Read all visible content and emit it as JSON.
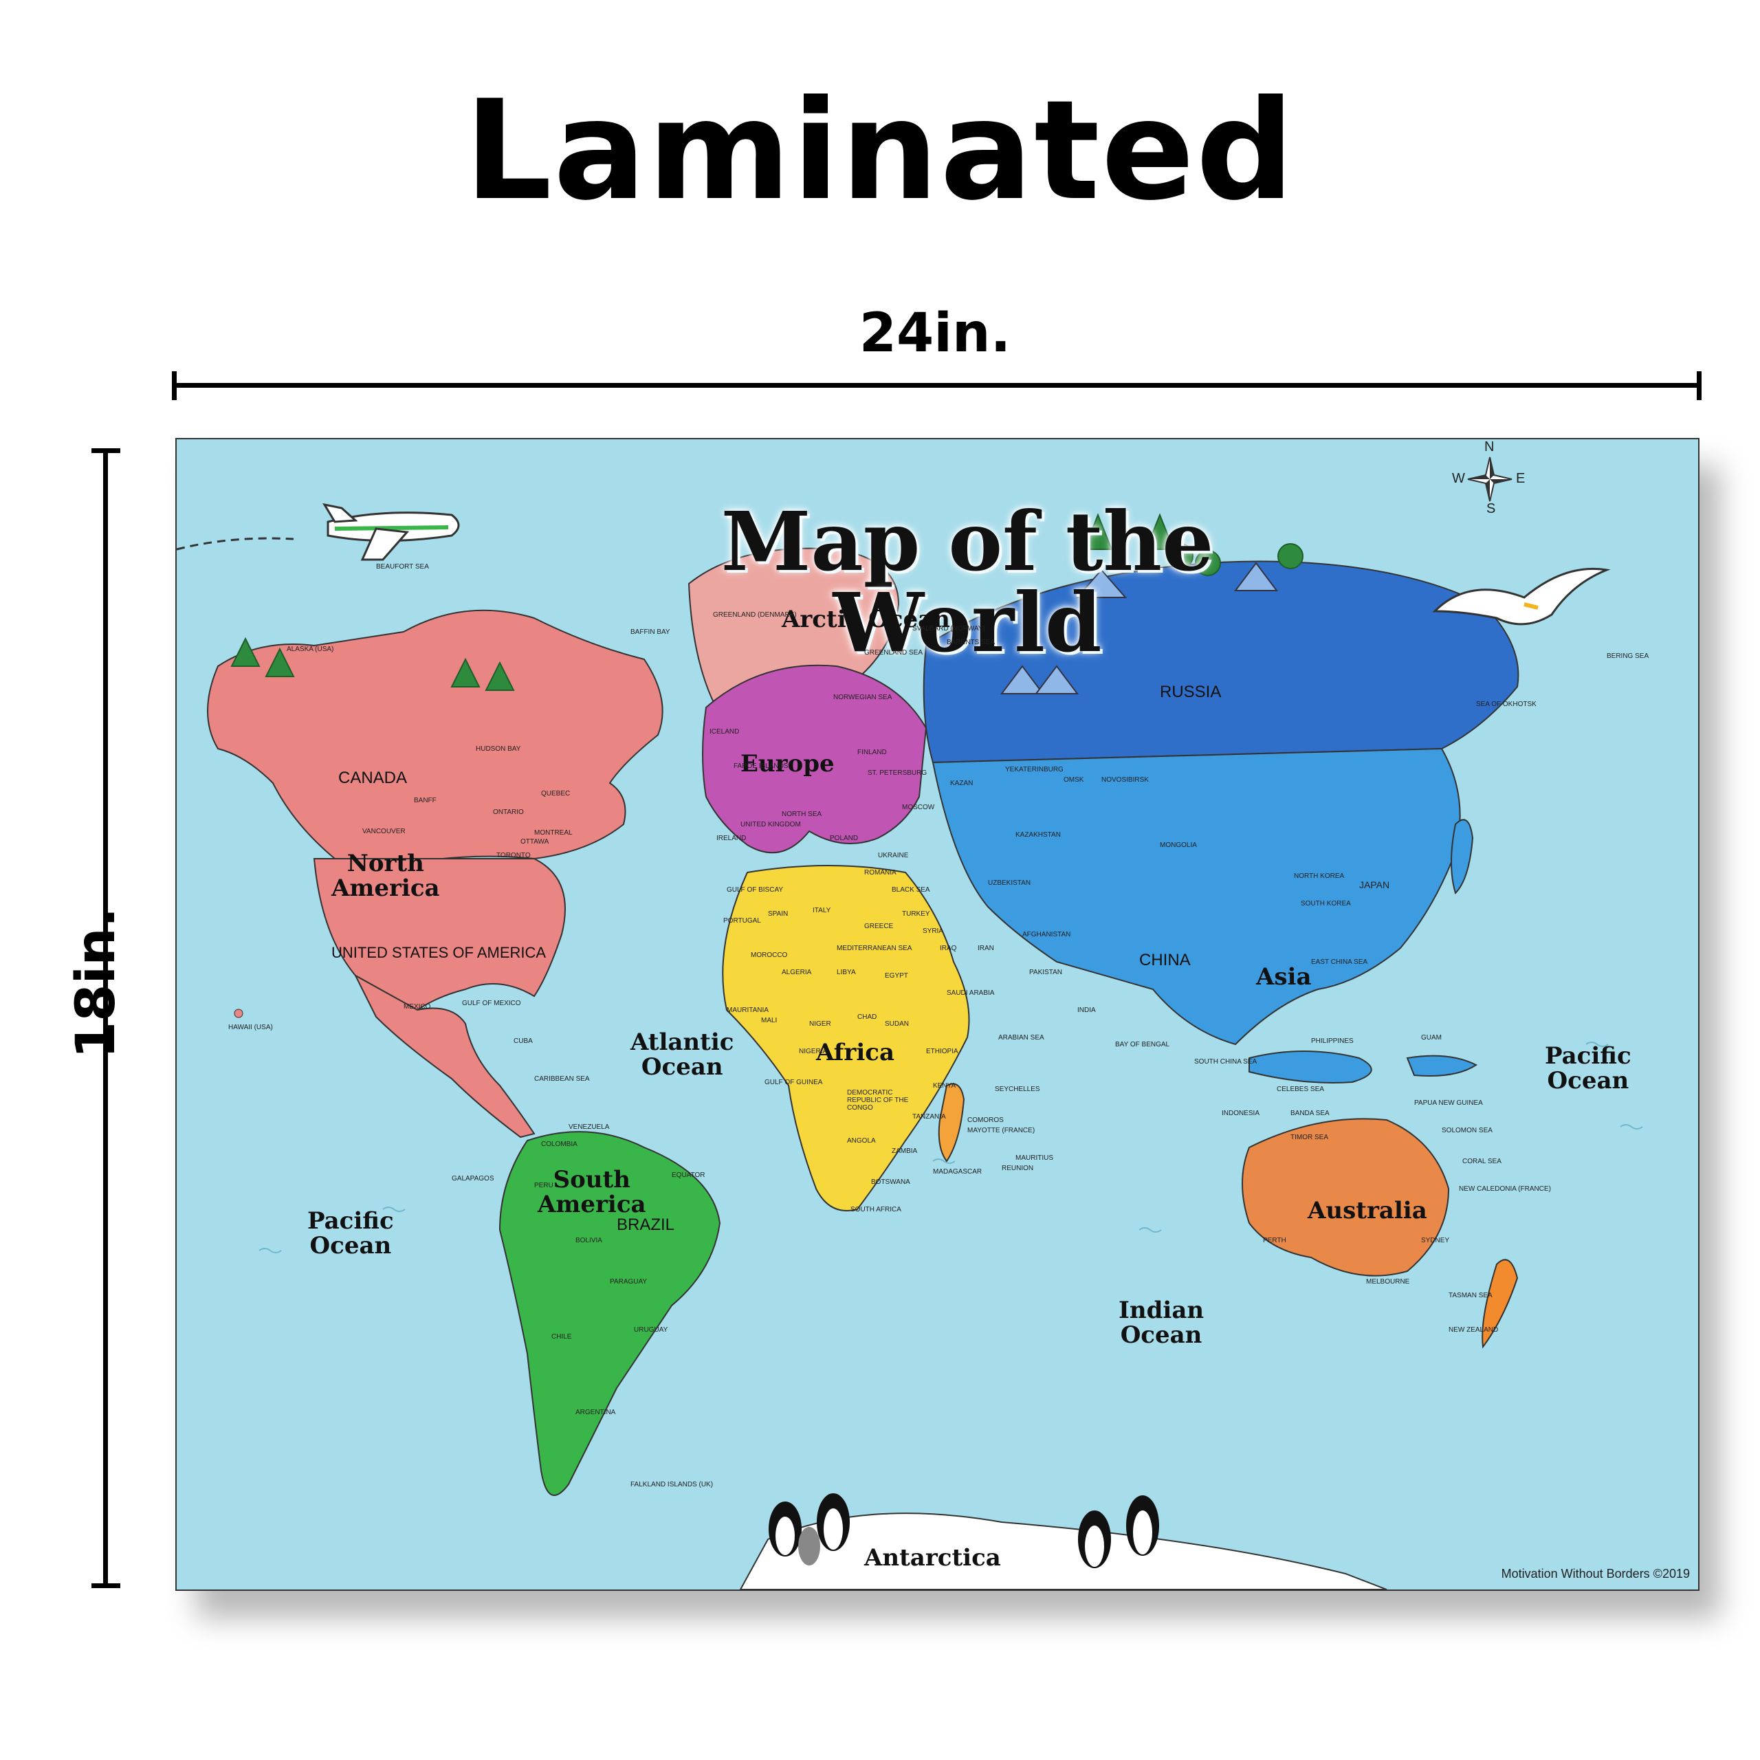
{
  "headline": "Laminated",
  "dimensions": {
    "width_label": "24in.",
    "height_label": "18in."
  },
  "poster": {
    "title": "Map of the World",
    "credit": "Motivation Without Borders ©2019",
    "compass": {
      "n": "N",
      "s": "S",
      "e": "E",
      "w": "W"
    },
    "continents": {
      "north_america": "North\nAmerica",
      "south_america": "South\nAmerica",
      "europe": "Europe",
      "africa": "Africa",
      "asia": "Asia",
      "australia": "Australia",
      "antarctica": "Antarctica"
    },
    "oceans": {
      "arctic": "Arctic Ocean",
      "atlantic": "Atlantic\nOcean",
      "pacific_west": "Pacific\nOcean",
      "pacific_east": "Pacific\nOcean",
      "indian": "Indian\nOcean"
    },
    "countries": {
      "canada": "CANADA",
      "usa": "UNITED STATES OF AMERICA",
      "russia": "RUSSIA",
      "china": "CHINA",
      "brazil": "BRAZIL"
    },
    "small_labels": {
      "beaufort_sea": "BEAUFORT SEA",
      "alaska": "ALASKA (USA)",
      "greenland": "GREENLAND (DENMARK)",
      "baffin_bay": "BAFFIN BAY",
      "greenland_sea": "GREENLAND SEA",
      "svalbard": "SVALBARD (NORWAY)",
      "barents_sea": "BARENTS SEA",
      "norwegian_sea": "NORWEGIAN SEA",
      "hudson_bay": "HUDSON BAY",
      "banff": "BANFF",
      "vancouver": "VANCOUVER",
      "ontario": "ONTARIO",
      "quebec": "QUEBEC",
      "montreal": "MONTREAL",
      "ottawa": "OTTAWA",
      "toronto": "TORONTO",
      "mexico": "MEXICO",
      "gulf_of_mexico": "GULF OF MEXICO",
      "cuba": "CUBA",
      "caribbean_sea": "CARIBBEAN SEA",
      "hawaii": "HAWAII (USA)",
      "venezuela": "VENEZUELA",
      "colombia": "COLOMBIA",
      "peru": "PERU",
      "bolivia": "BOLIVIA",
      "chile": "CHILE",
      "argentina": "ARGENTINA",
      "paraguay": "PARAGUAY",
      "uruguay": "URUGUAY",
      "galapagos": "GALAPAGOS",
      "equator": "EQUATOR",
      "falkland": "FALKLAND ISLANDS (UK)",
      "united_kingdom": "UNITED KINGDOM",
      "north_sea": "NORTH SEA",
      "ireland": "IRELAND",
      "gulf_of_biscay": "GULF OF BISCAY",
      "portugal": "PORTUGAL",
      "spain": "SPAIN",
      "italy": "ITALY",
      "greece": "GREECE",
      "poland": "POLAND",
      "ukraine": "UKRAINE",
      "romania": "ROMANIA",
      "finland": "FINLAND",
      "faroe": "FAROE ISLANDS",
      "iceland": "ICELAND",
      "mediterranean": "MEDITERRANEAN SEA",
      "black_sea": "BLACK SEA",
      "turkey": "TURKEY",
      "st_petersburg": "ST. PETERSBURG",
      "moscow": "MOSCOW",
      "kazan": "KAZAN",
      "yekaterinburg": "YEKATERINBURG",
      "omsk": "OMSK",
      "novosibirsk": "NOVOSIBIRSK",
      "kazakhstan": "KAZAKHSTAN",
      "mongolia": "MONGOLIA",
      "uzbekistan": "UZBEKISTAN",
      "afghanistan": "AFGHANISTAN",
      "pakistan": "PAKISTAN",
      "india": "INDIA",
      "iran": "IRAN",
      "iraq": "IRAQ",
      "syria": "SYRIA",
      "saudi_arabia": "SAUDI ARABIA",
      "arabian_sea": "ARABIAN SEA",
      "bay_of_bengal": "BAY OF BENGAL",
      "north_korea": "NORTH KOREA",
      "south_korea": "SOUTH KOREA",
      "japan": "JAPAN",
      "east_china_sea": "EAST CHINA SEA",
      "south_china_sea": "SOUTH CHINA SEA",
      "philippines": "PHILIPPINES",
      "guam": "GUAM",
      "indonesia": "INDONESIA",
      "banda_sea": "BANDA SEA",
      "celebes_sea": "CELEBES SEA",
      "papua": "PAPUA NEW GUINEA",
      "solomon_sea": "SOLOMON SEA",
      "timor_sea": "TIMOR SEA",
      "coral_sea": "CORAL SEA",
      "new_caledonia": "NEW CALEDONIA (FRANCE)",
      "perth": "PERTH",
      "sydney": "SYDNEY",
      "melbourne": "MELBOURNE",
      "tasman_sea": "TASMAN SEA",
      "new_zealand": "NEW ZEALAND",
      "bering_sea": "BERING SEA",
      "sea_of_okhotsk": "SEA OF OKHOTSK",
      "morocco": "MOROCCO",
      "algeria": "ALGERIA",
      "libya": "LIBYA",
      "egypt": "EGYPT",
      "mauritania": "MAURITANIA",
      "mali": "MALI",
      "niger": "NIGER",
      "chad": "CHAD",
      "sudan": "SUDAN",
      "ethiopia": "ETHIOPIA",
      "nigeria": "NIGERIA",
      "gulf_of_guinea": "GULF OF GUINEA",
      "drc": "DEMOCRATIC REPUBLIC OF THE CONGO",
      "kenya": "KENYA",
      "tanzania": "TANZANIA",
      "angola": "ANGOLA",
      "zambia": "ZAMBIA",
      "botswana": "BOTSWANA",
      "south_africa": "SOUTH AFRICA",
      "madagascar": "MADAGASCAR",
      "comoros": "COMOROS",
      "mayotte": "MAYOTTE (FRANCE)",
      "seychelles": "SEYCHELLES",
      "mauritius": "MAURITIUS",
      "reunion": "REUNION"
    }
  }
}
